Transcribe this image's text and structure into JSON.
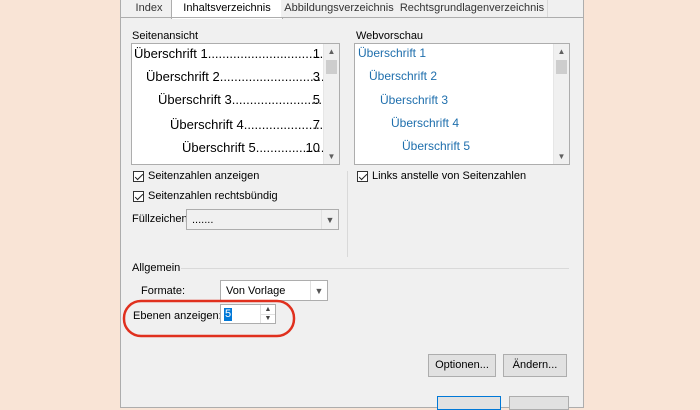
{
  "tabs": [
    {
      "label": "Index"
    },
    {
      "label": "Inhaltsverzeichnis"
    },
    {
      "label": "Abbildungsverzeichnis"
    },
    {
      "label": "Rechtsgrundlagenverzeichnis"
    }
  ],
  "print_preview": {
    "label": "Seitenansicht",
    "entries": [
      {
        "heading": "Überschrift 1",
        "dots": ".......................................",
        "page": "1"
      },
      {
        "heading": "Überschrift 2",
        "dots": ".................................",
        "page": "3"
      },
      {
        "heading": "Überschrift 3",
        "dots": "...............................",
        "page": "5"
      },
      {
        "heading": "Überschrift 4",
        "dots": "..........................",
        "page": "7"
      },
      {
        "heading": "Überschrift 5",
        "dots": ".....................",
        "page": "10"
      }
    ]
  },
  "web_preview": {
    "label": "Webvorschau",
    "entries": [
      "Überschrift 1",
      "Überschrift 2",
      "Überschrift 3",
      "Überschrift 4",
      "Überschrift 5"
    ]
  },
  "options": {
    "show_page_numbers": {
      "label": "Seitenzahlen anzeigen",
      "checked": true
    },
    "right_align": {
      "label": "Seitenzahlen rechtsbündig",
      "checked": true
    },
    "tab_leader": {
      "label": "Füllzeichen:",
      "value": "......."
    },
    "use_hyperlinks": {
      "label": "Links anstelle von Seitenzahlen",
      "checked": true
    }
  },
  "general": {
    "title": "Allgemein",
    "formats_label": "Formate:",
    "formats_value": "Von Vorlage",
    "levels_label": "Ebenen anzeigen:",
    "levels_value": "5"
  },
  "buttons": {
    "options": "Optionen...",
    "modify": "Ändern..."
  },
  "colors": {
    "link": "#1f6fad",
    "highlight_circle": "#e0301e",
    "background": "#f9e4d6"
  }
}
